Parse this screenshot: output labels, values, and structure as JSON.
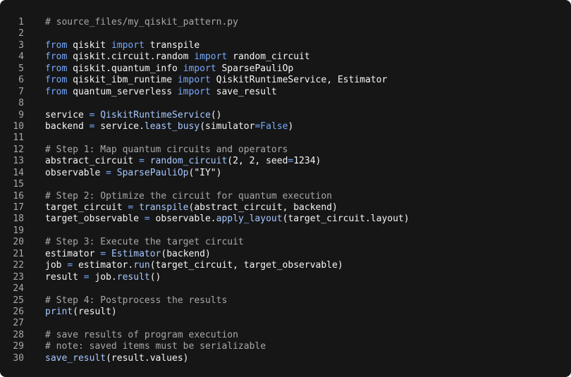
{
  "editor": {
    "colors": {
      "background": "#161616",
      "text": "#f4f4f4",
      "keyword": "#78a9ff",
      "function": "#a6c8ff",
      "comment": "#a8a8a8",
      "line_number": "#a8a8a8"
    },
    "lines": [
      {
        "n": "1",
        "tokens": [
          {
            "t": "cm",
            "v": "# source_files/my_qiskit_pattern.py"
          }
        ]
      },
      {
        "n": "2",
        "tokens": []
      },
      {
        "n": "3",
        "tokens": [
          {
            "t": "kw",
            "v": "from"
          },
          {
            "t": "tx",
            "v": " qiskit "
          },
          {
            "t": "kw",
            "v": "import"
          },
          {
            "t": "tx",
            "v": " transpile"
          }
        ]
      },
      {
        "n": "4",
        "tokens": [
          {
            "t": "kw",
            "v": "from"
          },
          {
            "t": "tx",
            "v": " qiskit.circuit.random "
          },
          {
            "t": "kw",
            "v": "import"
          },
          {
            "t": "tx",
            "v": " random_circuit"
          }
        ]
      },
      {
        "n": "5",
        "tokens": [
          {
            "t": "kw",
            "v": "from"
          },
          {
            "t": "tx",
            "v": " qiskit.quantum_info "
          },
          {
            "t": "kw",
            "v": "import"
          },
          {
            "t": "tx",
            "v": " SparsePauliOp"
          }
        ]
      },
      {
        "n": "6",
        "tokens": [
          {
            "t": "kw",
            "v": "from"
          },
          {
            "t": "tx",
            "v": " qiskit_ibm_runtime "
          },
          {
            "t": "kw",
            "v": "import"
          },
          {
            "t": "tx",
            "v": " QiskitRuntimeService, Estimator"
          }
        ]
      },
      {
        "n": "7",
        "tokens": [
          {
            "t": "kw",
            "v": "from"
          },
          {
            "t": "tx",
            "v": " quantum_serverless "
          },
          {
            "t": "kw",
            "v": "import"
          },
          {
            "t": "tx",
            "v": " save_result"
          }
        ]
      },
      {
        "n": "8",
        "tokens": []
      },
      {
        "n": "9",
        "tokens": [
          {
            "t": "tx",
            "v": "service "
          },
          {
            "t": "kw",
            "v": "="
          },
          {
            "t": "tx",
            "v": " "
          },
          {
            "t": "fn",
            "v": "QiskitRuntimeService"
          },
          {
            "t": "tx",
            "v": "()"
          }
        ]
      },
      {
        "n": "10",
        "tokens": [
          {
            "t": "tx",
            "v": "backend "
          },
          {
            "t": "kw",
            "v": "="
          },
          {
            "t": "tx",
            "v": " service."
          },
          {
            "t": "fn",
            "v": "least_busy"
          },
          {
            "t": "tx",
            "v": "(simulator"
          },
          {
            "t": "kw",
            "v": "=False"
          },
          {
            "t": "tx",
            "v": ")"
          }
        ]
      },
      {
        "n": "11",
        "tokens": []
      },
      {
        "n": "12",
        "tokens": [
          {
            "t": "cm",
            "v": "# Step 1: Map quantum circuits and operators"
          }
        ]
      },
      {
        "n": "13",
        "tokens": [
          {
            "t": "tx",
            "v": "abstract_circuit "
          },
          {
            "t": "kw",
            "v": "="
          },
          {
            "t": "tx",
            "v": " "
          },
          {
            "t": "fn",
            "v": "random_circuit"
          },
          {
            "t": "tx",
            "v": "(2, 2, seed"
          },
          {
            "t": "kw",
            "v": "="
          },
          {
            "t": "tx",
            "v": "1234)"
          }
        ]
      },
      {
        "n": "14",
        "tokens": [
          {
            "t": "tx",
            "v": "observable "
          },
          {
            "t": "kw",
            "v": "="
          },
          {
            "t": "tx",
            "v": " "
          },
          {
            "t": "fn",
            "v": "SparsePauliOp"
          },
          {
            "t": "tx",
            "v": "(\"IY\")"
          }
        ]
      },
      {
        "n": "15",
        "tokens": []
      },
      {
        "n": "16",
        "tokens": [
          {
            "t": "cm",
            "v": "# Step 2: Optimize the circuit for quantum execution"
          }
        ]
      },
      {
        "n": "17",
        "tokens": [
          {
            "t": "tx",
            "v": "target_circuit "
          },
          {
            "t": "kw",
            "v": "="
          },
          {
            "t": "tx",
            "v": " "
          },
          {
            "t": "fn",
            "v": "transpile"
          },
          {
            "t": "tx",
            "v": "(abstract_circuit, backend)"
          }
        ]
      },
      {
        "n": "18",
        "tokens": [
          {
            "t": "tx",
            "v": "target_observable "
          },
          {
            "t": "kw",
            "v": "="
          },
          {
            "t": "tx",
            "v": " observable."
          },
          {
            "t": "fn",
            "v": "apply_layout"
          },
          {
            "t": "tx",
            "v": "(target_circuit.layout)"
          }
        ]
      },
      {
        "n": "19",
        "tokens": []
      },
      {
        "n": "20",
        "tokens": [
          {
            "t": "cm",
            "v": "# Step 3: Execute the target circuit"
          }
        ]
      },
      {
        "n": "21",
        "tokens": [
          {
            "t": "tx",
            "v": "estimator "
          },
          {
            "t": "kw",
            "v": "="
          },
          {
            "t": "tx",
            "v": " "
          },
          {
            "t": "fn",
            "v": "Estimator"
          },
          {
            "t": "tx",
            "v": "(backend)"
          }
        ]
      },
      {
        "n": "22",
        "tokens": [
          {
            "t": "tx",
            "v": "job "
          },
          {
            "t": "kw",
            "v": "="
          },
          {
            "t": "tx",
            "v": " estimator."
          },
          {
            "t": "fn",
            "v": "run"
          },
          {
            "t": "tx",
            "v": "(target_circuit, target_observable)"
          }
        ]
      },
      {
        "n": "23",
        "tokens": [
          {
            "t": "tx",
            "v": "result "
          },
          {
            "t": "kw",
            "v": "="
          },
          {
            "t": "tx",
            "v": " job."
          },
          {
            "t": "fn",
            "v": "result"
          },
          {
            "t": "tx",
            "v": "()"
          }
        ]
      },
      {
        "n": "24",
        "tokens": []
      },
      {
        "n": "25",
        "tokens": [
          {
            "t": "cm",
            "v": "# Step 4: Postprocess the results"
          }
        ]
      },
      {
        "n": "26",
        "tokens": [
          {
            "t": "fn",
            "v": "print"
          },
          {
            "t": "tx",
            "v": "(result)"
          }
        ]
      },
      {
        "n": "27",
        "tokens": []
      },
      {
        "n": "28",
        "tokens": [
          {
            "t": "cm",
            "v": "# save results of program execution"
          }
        ]
      },
      {
        "n": "29",
        "tokens": [
          {
            "t": "cm",
            "v": "# note: saved items must be serializable"
          }
        ]
      },
      {
        "n": "30",
        "tokens": [
          {
            "t": "fn",
            "v": "save_result"
          },
          {
            "t": "tx",
            "v": "(result.values)"
          }
        ]
      }
    ]
  }
}
